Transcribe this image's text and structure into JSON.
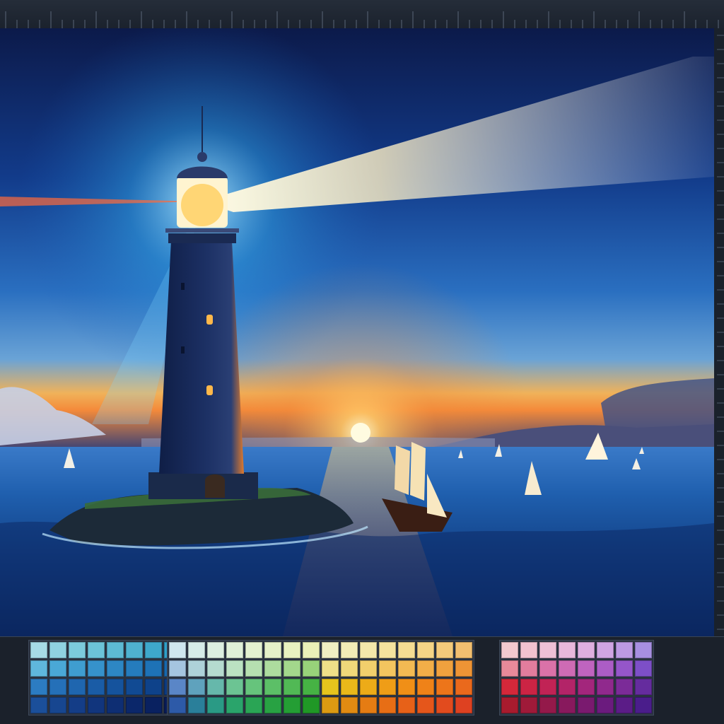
{
  "app": {
    "accent": "#3a4555",
    "background": "#1e2531"
  },
  "canvas": {
    "icon": "image-canvas-icon"
  },
  "palette": {
    "groups": [
      {
        "name": "blues",
        "colors": [
          "#a7dbe6",
          "#8fd2e0",
          "#7ccbdc",
          "#6cc3d8",
          "#5dbad4",
          "#4fb2d0",
          "#3ea8cb",
          "#2f9fc7",
          "#5fb7dc",
          "#4aa8d6",
          "#3f9dd0",
          "#3692cb",
          "#2d87c4",
          "#257cbd",
          "#1e72b6",
          "#1768ae",
          "#2c7cc2",
          "#2570b8",
          "#1f66af",
          "#1a5ca6",
          "#15539d",
          "#114a93",
          "#0e428a",
          "#0b3a80",
          "#1b4f9a",
          "#174690",
          "#143d87",
          "#11357d",
          "#0e2e73",
          "#0b276a",
          "#092160",
          "#071b57"
        ]
      },
      {
        "name": "greens",
        "colors": [
          "#cfe6ef",
          "#d6ebe8",
          "#dceee0",
          "#e0f0d8",
          "#e4f1d0",
          "#e6f1c8",
          "#e8f1c0",
          "#eaf0b8",
          "#a5c5e0",
          "#aed2d9",
          "#b5dbcf",
          "#bbe2c2",
          "#b6e0b0",
          "#addc9e",
          "#a3d78c",
          "#98d27a",
          "#5a86c7",
          "#5fa2bd",
          "#66b8ab",
          "#6cc493",
          "#66c47c",
          "#5cbf67",
          "#51b955",
          "#46b244",
          "#2d5aa8",
          "#2a7f9a",
          "#2a9a85",
          "#2aa46b",
          "#2aa555",
          "#28a243",
          "#249e34",
          "#209826"
        ]
      },
      {
        "name": "yellows",
        "colors": [
          "#f0efc2",
          "#f2ecb6",
          "#f4e8aa",
          "#f5e39e",
          "#f5dc92",
          "#f5d486",
          "#f4ca7b",
          "#f2bf70",
          "#eedf88",
          "#f0d87a",
          "#f2cf6c",
          "#f3c55f",
          "#f3ba53",
          "#f2ae48",
          "#f0a13e",
          "#ee9435",
          "#e6c41d",
          "#eab81a",
          "#edab18",
          "#ef9d17",
          "#f08f17",
          "#ef8218",
          "#ed751a",
          "#ea691c",
          "#dc9a12",
          "#e28b12",
          "#e57c13",
          "#e76e15",
          "#e76118",
          "#e5561b",
          "#e24b1e",
          "#de4121"
        ]
      },
      {
        "name": "reds-purples",
        "colors": [
          "#f3c9cf",
          "#f1c2cf",
          "#eec0d6",
          "#e8b8db",
          "#dfafe0",
          "#d0a5e3",
          "#bd9ae3",
          "#a78fe0",
          "#e88a9a",
          "#e27d9d",
          "#da72a8",
          "#ce6bb4",
          "#bf64bf",
          "#ac5dc6",
          "#9556c9",
          "#7d4fc7",
          "#d4283a",
          "#cc2444",
          "#c12355",
          "#b32468",
          "#a3267c",
          "#90298d",
          "#7b2b98",
          "#652c9e",
          "#a81b2e",
          "#9f1a39",
          "#94194a",
          "#88195d",
          "#7a1a6f",
          "#6b1b7e",
          "#5b1c87",
          "#4a1d8b"
        ]
      }
    ]
  }
}
